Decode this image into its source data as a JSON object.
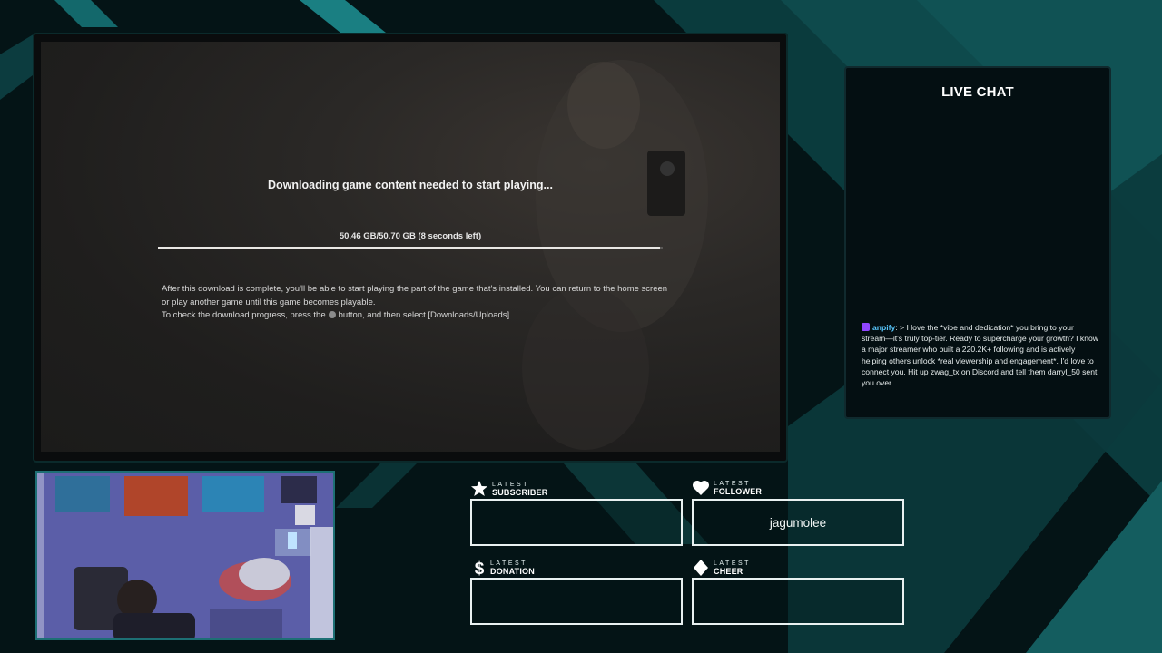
{
  "game": {
    "title": "Downloading game content needed to start playing...",
    "progress_text": "50.46 GB/50.70 GB (8 seconds left)",
    "progress": 0.995,
    "info_line1": "After this download is complete, you'll be able to start playing the part of the game that's installed. You can return to the home screen or play another game until this game becomes playable.",
    "info_line2_before": "To check the download progress, press the",
    "info_line2_after": "button, and then select [Downloads/Uploads]."
  },
  "chat": {
    "title": "LIVE CHAT",
    "messages": [
      {
        "user": "anpify",
        "text": ": > I love the *vibe and dedication* you bring to your stream—it's truly top-tier. Ready to supercharge your growth? I know a major streamer who built a 220.2K+ following and is actively helping others unlock *real viewership and engagement*. I'd love to connect you. Hit up zwag_tx on Discord and tell them darryl_50 sent you over."
      }
    ]
  },
  "widgets": {
    "subscriber": {
      "label_small": "LATEST",
      "label_big": "SUBSCRIBER",
      "value": ""
    },
    "follower": {
      "label_small": "LATEST",
      "label_big": "FOLLOWER",
      "value": "jagumolee"
    },
    "donation": {
      "label_small": "LATEST",
      "label_big": "DONATION",
      "value": ""
    },
    "cheer": {
      "label_small": "LATEST",
      "label_big": "CHEER",
      "value": ""
    }
  },
  "icons": {
    "subscriber": "star-icon",
    "follower": "heart-icon",
    "donation": "dollar-icon",
    "cheer": "diamond-icon"
  },
  "colors": {
    "accent_teal": "#0f6b6f",
    "chat_username": "#59c9ff",
    "chat_badge": "#9146ff"
  }
}
